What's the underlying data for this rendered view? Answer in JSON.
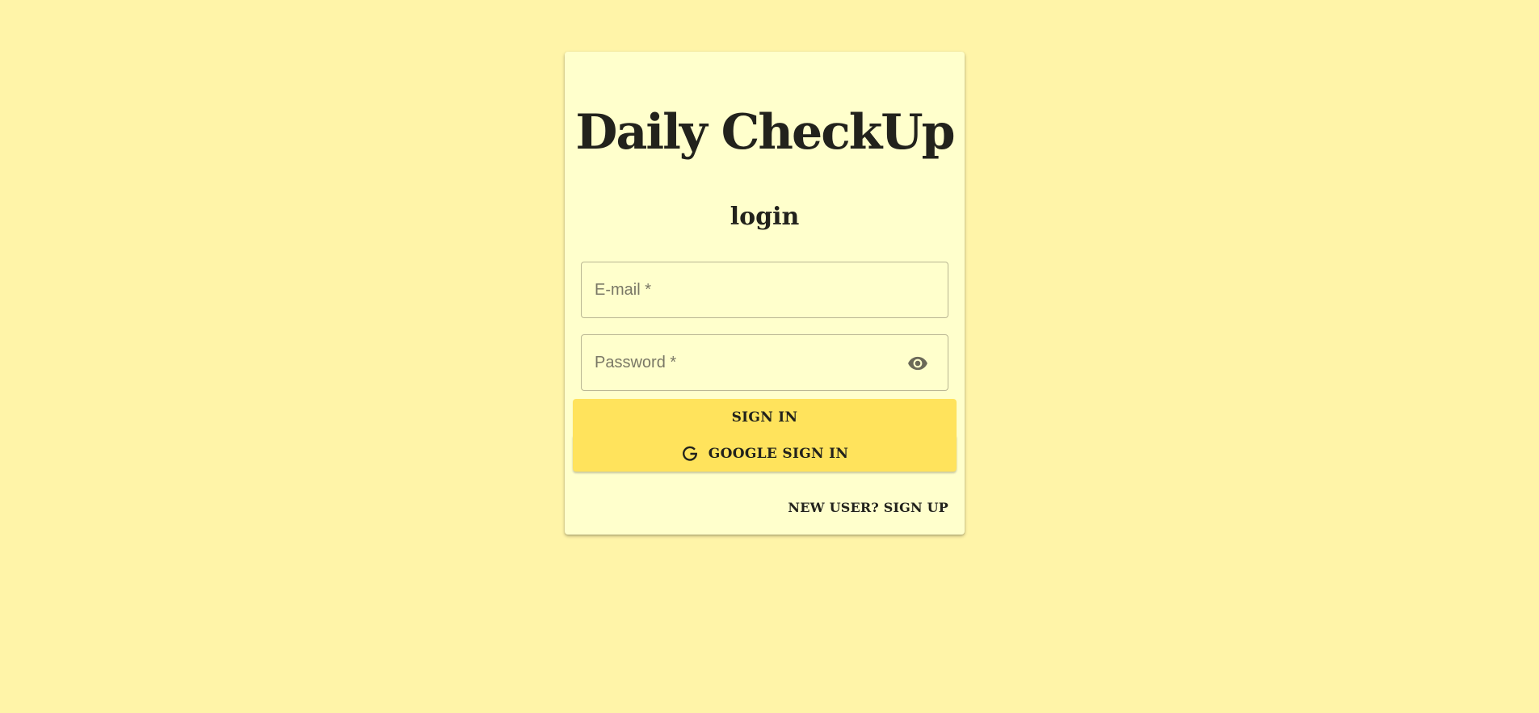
{
  "app": {
    "title": "Daily CheckUp",
    "subtitle": "login"
  },
  "form": {
    "email": {
      "placeholder": "E-mail *",
      "value": ""
    },
    "password": {
      "placeholder": "Password *",
      "value": "",
      "toggle_icon": "eye-icon"
    }
  },
  "buttons": {
    "sign_in_label": "SIGN IN",
    "google_sign_in_label": "GOOGLE SIGN IN",
    "google_icon": "google-g-icon"
  },
  "footer": {
    "signup_label": "NEW USER? SIGN UP"
  },
  "colors": {
    "background": "#fff4a8",
    "card": "#ffffcc",
    "button": "#ffe35c",
    "text": "#22221c"
  }
}
